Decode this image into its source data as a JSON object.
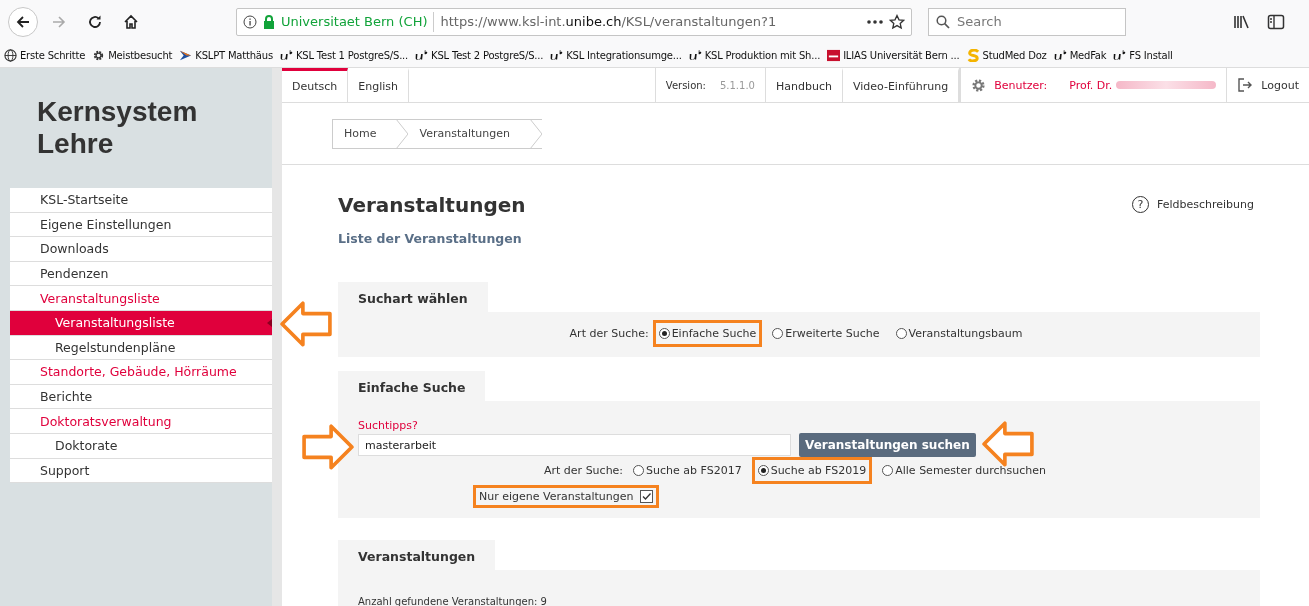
{
  "browser": {
    "identity": "Universitaet Bern (CH)",
    "url_host_prefix": "https://www.ksl-int.",
    "url_host": "unibe.ch",
    "url_path": "/KSL/veranstaltungen?1",
    "search_placeholder": "Search",
    "bookmarks": [
      {
        "label": "Erste Schritte",
        "kind": "globe"
      },
      {
        "label": "Meistbesucht",
        "kind": "gear"
      },
      {
        "label": "KSLPT Matthäus",
        "kind": "chevron"
      },
      {
        "label": "KSL Test 1 PostgreS/S...",
        "kind": "ub"
      },
      {
        "label": "KSL Test 2 PostgreS/S...",
        "kind": "ub"
      },
      {
        "label": "KSL Integrationsumge...",
        "kind": "ub"
      },
      {
        "label": "KSL Produktion mit Sh...",
        "kind": "ub"
      },
      {
        "label": "ILIAS Universität Bern ...",
        "kind": "ilias"
      },
      {
        "label": "StudMed Doz",
        "kind": "s"
      },
      {
        "label": "MedFak",
        "kind": "ub"
      },
      {
        "label": "FS Install",
        "kind": "ub"
      }
    ]
  },
  "sidebar": {
    "title": "Kernsystem Lehre",
    "items": [
      {
        "label": "KSL-Startseite",
        "highlighted": false,
        "selected": false
      },
      {
        "label": "Eigene Einstellungen",
        "highlighted": false,
        "selected": false
      },
      {
        "label": "Downloads",
        "highlighted": false,
        "selected": false
      },
      {
        "label": "Pendenzen",
        "highlighted": false,
        "selected": false
      },
      {
        "label": "Veranstaltungsliste",
        "highlighted": true,
        "selected": false,
        "children": [
          {
            "label": "Veranstaltungsliste",
            "highlighted": false,
            "selected": true,
            "arrow_marked": true
          },
          {
            "label": "Regelstundenpläne",
            "highlighted": false,
            "selected": false
          }
        ]
      },
      {
        "label": "Standorte, Gebäude, Hörräume",
        "highlighted": true,
        "selected": false
      },
      {
        "label": "Berichte",
        "highlighted": false,
        "selected": false
      },
      {
        "label": "Doktoratsverwaltung",
        "highlighted": true,
        "selected": false,
        "children": [
          {
            "label": "Doktorate",
            "highlighted": false,
            "selected": false
          }
        ]
      },
      {
        "label": "Support",
        "highlighted": false,
        "selected": false
      }
    ]
  },
  "topnav": {
    "languages": [
      {
        "label": "Deutsch",
        "selected": true
      },
      {
        "label": "English",
        "selected": false
      }
    ],
    "version_label": "Version:",
    "version": "5.1.1.0",
    "links": [
      "Handbuch",
      "Video-Einführung"
    ],
    "user_label": "Benutzer:",
    "user": "Prof. Dr.",
    "logout": "Logout"
  },
  "breadcrumb": [
    "Home",
    "Veranstaltungen"
  ],
  "page": {
    "title": "Veranstaltungen",
    "subtitle": "Liste der Veranstaltungen",
    "help_icon": "?",
    "help": "Feldbeschreibung"
  },
  "search_type": {
    "heading": "Suchart wählen",
    "label": "Art der Suche:",
    "options": [
      {
        "label": "Einfache Suche",
        "selected": true,
        "highlighted": true
      },
      {
        "label": "Erweiterte Suche",
        "selected": false,
        "highlighted": false
      },
      {
        "label": "Veranstaltungsbaum",
        "selected": false,
        "highlighted": false
      }
    ]
  },
  "simple_search": {
    "heading": "Einfache Suche",
    "tips": "Suchtipps?",
    "value": "masterarbeit",
    "field_arrow_marked": true,
    "button": "Veranstaltungen suchen",
    "button_arrow_marked": true,
    "label": "Art der Suche:",
    "options": [
      {
        "label": "Suche ab FS2017",
        "selected": false,
        "highlighted": false
      },
      {
        "label": "Suche ab FS2019",
        "selected": true,
        "highlighted": true
      },
      {
        "label": "Alle Semester durchsuchen",
        "selected": false,
        "highlighted": false
      }
    ],
    "own_only": {
      "label": "Nur eigene Veranstaltungen",
      "checked": true,
      "highlighted": true
    }
  },
  "results": {
    "heading": "Veranstaltungen",
    "count": "Anzahl gefundene Veranstaltungen: 9"
  }
}
